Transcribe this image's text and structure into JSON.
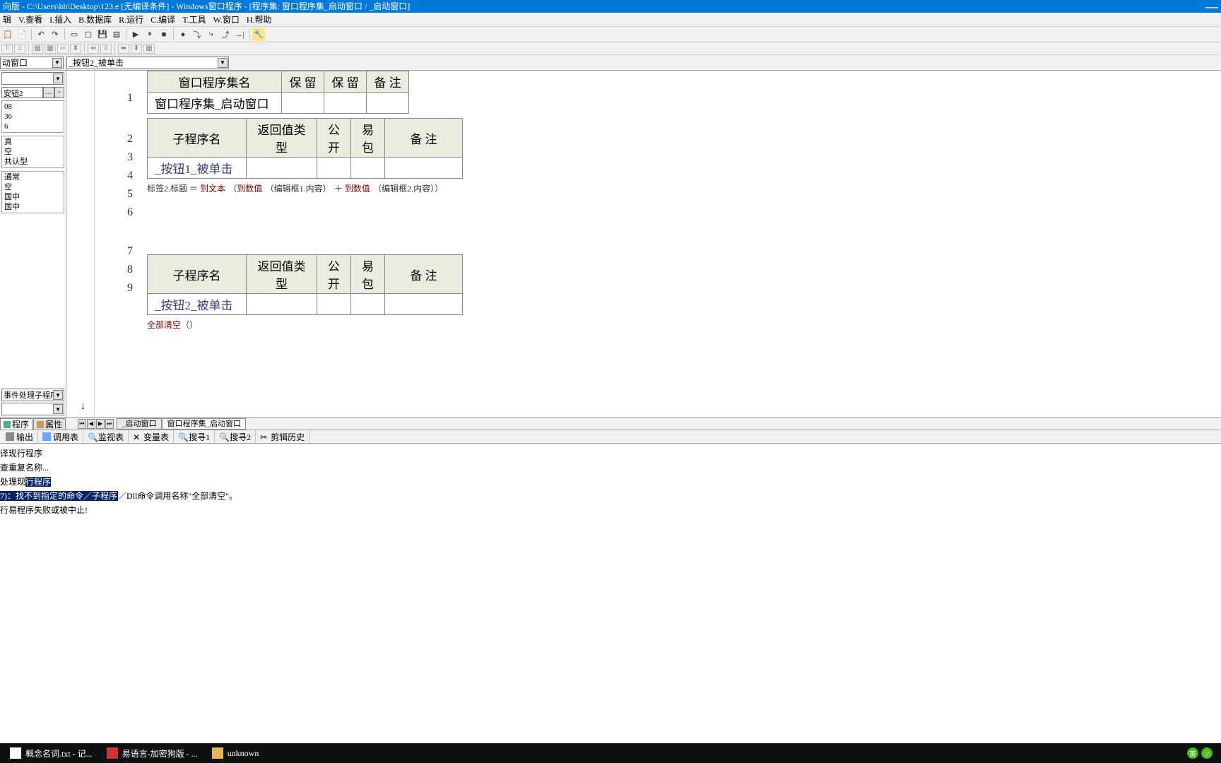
{
  "title": "向版 - C:\\Users\\hh\\Desktop\\123.e [无编译条件] - Windows窗口程序 - [程序集: 窗口程序集_启动窗口 / _启动窗口]",
  "menu": {
    "edit": "辑",
    "view": "V.查看",
    "insert": "I.插入",
    "db": "B.数据库",
    "run": "R.运行",
    "compile": "C.编译",
    "tools": "T.工具",
    "window": "W.窗口",
    "help": "H.帮助"
  },
  "dropbar": {
    "sel1": "动窗口",
    "sel2": "_按钮2_被单击"
  },
  "left": {
    "sel": "安钮2",
    "vals": [
      "08",
      "36",
      "6"
    ],
    "group1": [
      "真",
      "空",
      "共认型"
    ],
    "group2": [
      "通常",
      "空",
      "国中",
      "国中"
    ],
    "bottomSel": "事件处理子程序"
  },
  "code": {
    "gutter": [
      "1",
      "2",
      "3",
      "4",
      "5",
      "6",
      "7",
      "8",
      "9"
    ],
    "table1": {
      "headers": [
        "窗口程序集名",
        "保  留",
        "保  留",
        "备  注"
      ],
      "row": [
        "窗口程序集_启动窗口",
        "",
        "",
        ""
      ]
    },
    "table2": {
      "headers": [
        "子程序名",
        "返回值类型",
        "公开",
        "易包",
        "备  注"
      ],
      "row": [
        "_按钮1_被单击",
        "",
        "",
        "",
        ""
      ]
    },
    "line3": {
      "prefix": "标签2.标题  ＝  ",
      "fn1": "到文本",
      "fn2": "到数值",
      "arg1": "编辑框1.内容",
      "plus": "＋",
      "arg2": "编辑框2.内容"
    },
    "table3": {
      "headers": [
        "子程序名",
        "返回值类型",
        "公开",
        "易包",
        "备  注"
      ],
      "row": [
        "_按钮2_被单击",
        "",
        "",
        "",
        ""
      ]
    },
    "line8": {
      "call": "全部清空",
      "paren": "（）"
    }
  },
  "codeTabs": {
    "t1": "_启动窗口",
    "t2": "窗口程序集_启动窗口"
  },
  "propTabs": {
    "t1": "程序",
    "t2": "属性"
  },
  "outTabs": {
    "t1": "输出",
    "t2": "调用表",
    "t3": "监视表",
    "t4": "变量表",
    "t5": "搜寻1",
    "t6": "搜寻2",
    "t7": "剪辑历史"
  },
  "output": {
    "l1": "译现行程序",
    "l2": "查重复名称...",
    "l3a": "处理现",
    "l3b": "行程序",
    "l4a": "7)：找不到指定的命令／子程序",
    "l4b": "／Dll命令调用名称\"全部清空\"。",
    "l5": "行易程序失败或被中止!"
  },
  "taskbar": {
    "t1": "概念名词.txt - 记...",
    "t2": "易语言-加密狗版 - ...",
    "t3": "unknown",
    "ime": "英"
  }
}
